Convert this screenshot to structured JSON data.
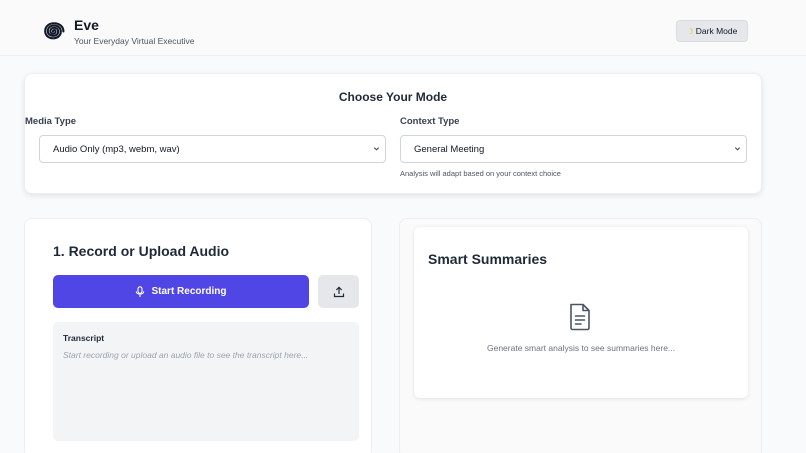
{
  "header": {
    "app_name": "Eve",
    "tagline": "Your Everyday Virtual Executive",
    "dark_mode_label": "Dark Mode"
  },
  "mode": {
    "title": "Choose Your Mode",
    "media_label": "Media Type",
    "media_value": "Audio Only (mp3, webm, wav)",
    "context_label": "Context Type",
    "context_value": "General Meeting",
    "hint": "Analysis will adapt based on your context choice"
  },
  "record": {
    "title": "1. Record or Upload Audio",
    "start_label": "Start Recording",
    "transcript_label": "Transcript",
    "transcript_placeholder": "Start recording or upload an audio file to see the transcript here..."
  },
  "summaries": {
    "title": "Smart Summaries",
    "placeholder": "Generate smart analysis to see summaries here..."
  },
  "colors": {
    "accent": "#4f46e5",
    "background": "#f9fafb"
  },
  "icons": [
    "spiral-logo-icon",
    "moon-icon",
    "chevron-down-icon",
    "microphone-icon",
    "upload-icon",
    "document-icon"
  ]
}
